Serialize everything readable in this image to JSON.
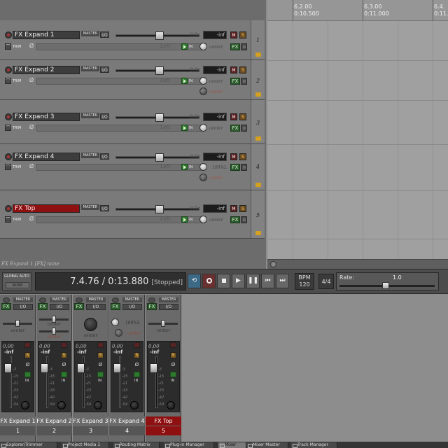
{
  "ruler": {
    "ticks": [
      {
        "bar": "6.2.00",
        "time": "0:10.500"
      },
      {
        "bar": "6.3.00",
        "time": "0:11.000"
      },
      {
        "bar": "6.4.",
        "time": "0:11."
      }
    ]
  },
  "tracks": [
    {
      "name": "FX Expand 1",
      "number": "1",
      "master": "MASTER",
      "io": "I/O",
      "vol": "0.0c",
      "meter": "-inf",
      "pan": "Left",
      "pan_knob": "center",
      "second_knob": "",
      "selected": false
    },
    {
      "name": "FX Expand 2",
      "number": "2",
      "master": "MASTER",
      "io": "I/O",
      "vol": "0.0c",
      "meter": "-inf",
      "pan": "Left",
      "pan_knob": "center",
      "second_knob": "center",
      "selected": false
    },
    {
      "name": "FX Expand 3",
      "number": "3",
      "master": "MASTER",
      "io": "I/O",
      "vol": "0.0c",
      "meter": "-inf",
      "pan": "Left",
      "pan_knob": "center",
      "second_knob": "",
      "selected": false
    },
    {
      "name": "FX Expand 4",
      "number": "4",
      "master": "MASTER",
      "io": "I/O",
      "vol": "0.0c",
      "meter": "-inf",
      "pan": "Left",
      "pan_knob": "100%L",
      "second_knob": "center",
      "selected": false
    },
    {
      "name": "FX Top",
      "number": "5",
      "master": "MASTER",
      "io": "I/O",
      "vol": "0.0c",
      "meter": "-inf",
      "pan": "Left",
      "pan_knob": "center",
      "second_knob": "",
      "selected": true
    }
  ],
  "track_labels": {
    "trim": "TRIM",
    "in": "IN",
    "fx": "FX",
    "mute": "M",
    "solo": "S",
    "phase": "Ø"
  },
  "status_line": "FX Expand 1 [FX] none",
  "transport": {
    "global_auto_title": "GLOBAL AUTO",
    "global_auto_value": "NONE",
    "position": "7.4.76 / 0:13.880",
    "state": "[Stopped]",
    "bpm_label": "BPM",
    "bpm_value": "120",
    "time_sig": "4/4",
    "rate_label": "Rate:",
    "rate_value": "1.0",
    "buttons": [
      "repeat",
      "record",
      "stop",
      "play",
      "pause",
      "go-start",
      "go-end"
    ]
  },
  "mixer": {
    "strips": [
      {
        "name": "FX Expand 1",
        "number": "1",
        "master": "MASTER",
        "io": "I/O",
        "fx": "FX",
        "pan": "center",
        "pan2": "",
        "vol": "0.00",
        "meter": "-inf",
        "selected": false,
        "knob_mode": false
      },
      {
        "name": "FX Expand 2",
        "number": "2",
        "master": "MASTER",
        "io": "I/O",
        "fx": "FX",
        "pan": "center",
        "pan2": "center",
        "vol": "0.00",
        "meter": "-inf",
        "selected": false,
        "knob_mode": false
      },
      {
        "name": "FX Expand 3",
        "number": "3",
        "master": "MASTER",
        "io": "I/O",
        "fx": "FX",
        "pan": "center",
        "pan2": "",
        "vol": "0.00",
        "meter": "-inf",
        "selected": false,
        "knob_mode": true
      },
      {
        "name": "FX Expand 4",
        "number": "4",
        "master": "MASTER",
        "io": "I/O",
        "fx": "FX",
        "pan": "100%L",
        "pan2": "center",
        "vol": "0.00",
        "meter": "-inf",
        "selected": false,
        "knob_mode": false
      },
      {
        "name": "FX Top",
        "number": "5",
        "master": "MASTER",
        "io": "I/O",
        "fx": "FX",
        "pan": "center",
        "pan2": "",
        "vol": "0.00",
        "meter": "-inf",
        "selected": true,
        "knob_mode": false
      }
    ],
    "scale": [
      "-3",
      "-15",
      "-21",
      "-33",
      "-42",
      "-54"
    ],
    "solo": "S",
    "phase": "Ø",
    "in": "IN"
  },
  "docker_tabs": [
    {
      "label": "Explorer/Trimmer",
      "active": false
    },
    {
      "label": "Project Media 1",
      "active": false
    },
    {
      "label": "Routing Matrix",
      "active": false
    },
    {
      "label": "Plug-in Manager",
      "active": false
    },
    {
      "label": "Mixer",
      "active": true
    },
    {
      "label": "Mixer Master",
      "active": false
    },
    {
      "label": "Track Manager",
      "active": false
    }
  ],
  "colors": {
    "selected_track": "#8e1010",
    "fx_green": "#2f5c2f",
    "arrange_bg": "#a0a0a0"
  }
}
